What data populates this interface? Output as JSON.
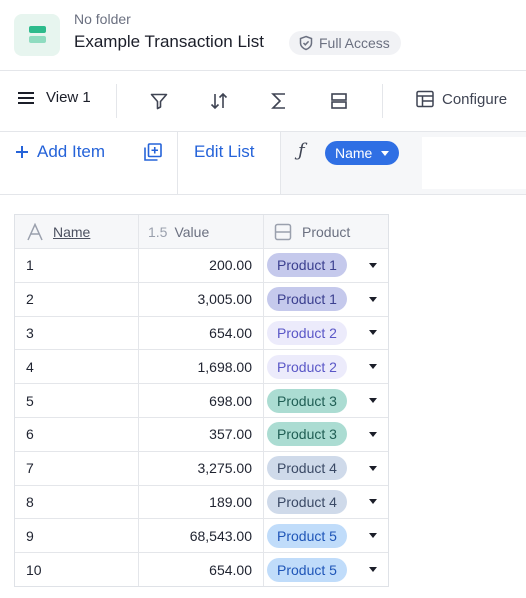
{
  "header": {
    "folder": "No folder",
    "title": "Example Transaction List",
    "access": "Full Access"
  },
  "toolbar": {
    "view_label": "View 1",
    "configure_label": "Configure",
    "icons": [
      "filter-icon",
      "sort-icon",
      "sum-icon",
      "group-icon"
    ]
  },
  "actionbar": {
    "add_item_label": "Add Item",
    "edit_list_label": "Edit List",
    "formula_symbol": "ƒ",
    "formula_field": "Name"
  },
  "table": {
    "columns": [
      {
        "type_icon": "A",
        "label": "Name"
      },
      {
        "type_icon": "1.5",
        "label": "Value"
      },
      {
        "type_icon": "select-icon",
        "label": "Product"
      }
    ],
    "rows": [
      {
        "name": "1",
        "value": "200.00",
        "product": "Product 1"
      },
      {
        "name": "2",
        "value": "3,005.00",
        "product": "Product 1"
      },
      {
        "name": "3",
        "value": "654.00",
        "product": "Product 2"
      },
      {
        "name": "4",
        "value": "1,698.00",
        "product": "Product 2"
      },
      {
        "name": "5",
        "value": "698.00",
        "product": "Product 3"
      },
      {
        "name": "6",
        "value": "357.00",
        "product": "Product 3"
      },
      {
        "name": "7",
        "value": "3,275.00",
        "product": "Product 4"
      },
      {
        "name": "8",
        "value": "189.00",
        "product": "Product 4"
      },
      {
        "name": "9",
        "value": "68,543.00",
        "product": "Product 5"
      },
      {
        "name": "10",
        "value": "654.00",
        "product": "Product 5"
      }
    ]
  },
  "colors": {
    "accent": "#2563d9",
    "product_chips": {
      "Product 1": {
        "bg": "#c5c9ec",
        "fg": "#3b3f8f"
      },
      "Product 2": {
        "bg": "#ecebfb",
        "fg": "#5a57c7"
      },
      "Product 3": {
        "bg": "#abdcd2",
        "fg": "#1f5e54"
      },
      "Product 4": {
        "bg": "#cfdaea",
        "fg": "#3b4a66"
      },
      "Product 5": {
        "bg": "#c0dcfa",
        "fg": "#1f56b8"
      }
    }
  }
}
